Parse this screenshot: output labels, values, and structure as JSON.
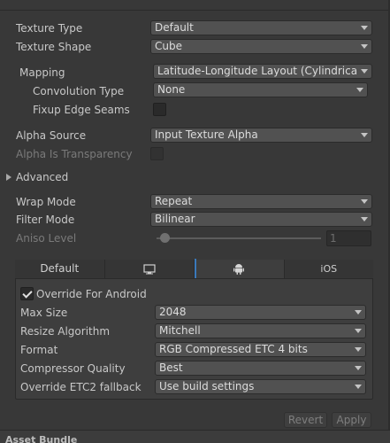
{
  "texture_type": {
    "label": "Texture Type",
    "value": "Default"
  },
  "texture_shape": {
    "label": "Texture Shape",
    "value": "Cube"
  },
  "mapping": {
    "label": "Mapping",
    "value": "Latitude-Longitude Layout (Cylindrica"
  },
  "convolution_type": {
    "label": "Convolution Type",
    "value": "None"
  },
  "fixup_edge_seams": {
    "label": "Fixup Edge Seams",
    "checked": false
  },
  "alpha_source": {
    "label": "Alpha Source",
    "value": "Input Texture Alpha"
  },
  "alpha_is_transparency": {
    "label": "Alpha Is Transparency",
    "checked": false
  },
  "advanced": {
    "label": "Advanced"
  },
  "wrap_mode": {
    "label": "Wrap Mode",
    "value": "Repeat"
  },
  "filter_mode": {
    "label": "Filter Mode",
    "value": "Bilinear"
  },
  "aniso_level": {
    "label": "Aniso Level",
    "value": "1",
    "level_fraction": 0.0
  },
  "platform_tabs": {
    "default_label": "Default",
    "monitor_icon": "monitor-icon",
    "android_icon": "android-icon",
    "ios_label": "iOS",
    "active": "android"
  },
  "android": {
    "override_label": "Override For Android",
    "override_checked": true,
    "max_size": {
      "label": "Max Size",
      "value": "2048"
    },
    "resize_algorithm": {
      "label": "Resize Algorithm",
      "value": "Mitchell"
    },
    "format": {
      "label": "Format",
      "value": "RGB Compressed ETC 4 bits"
    },
    "compressor_quality": {
      "label": "Compressor Quality",
      "value": "Best"
    },
    "etc2_fallback": {
      "label": "Override ETC2 fallback",
      "value": "Use build settings"
    }
  },
  "buttons": {
    "revert": "Revert",
    "apply": "Apply"
  },
  "footer": {
    "partial_header": "Asset Bundle"
  },
  "colors": {
    "background": "#383838",
    "accent": "#3a79bb",
    "field": "#515151"
  }
}
